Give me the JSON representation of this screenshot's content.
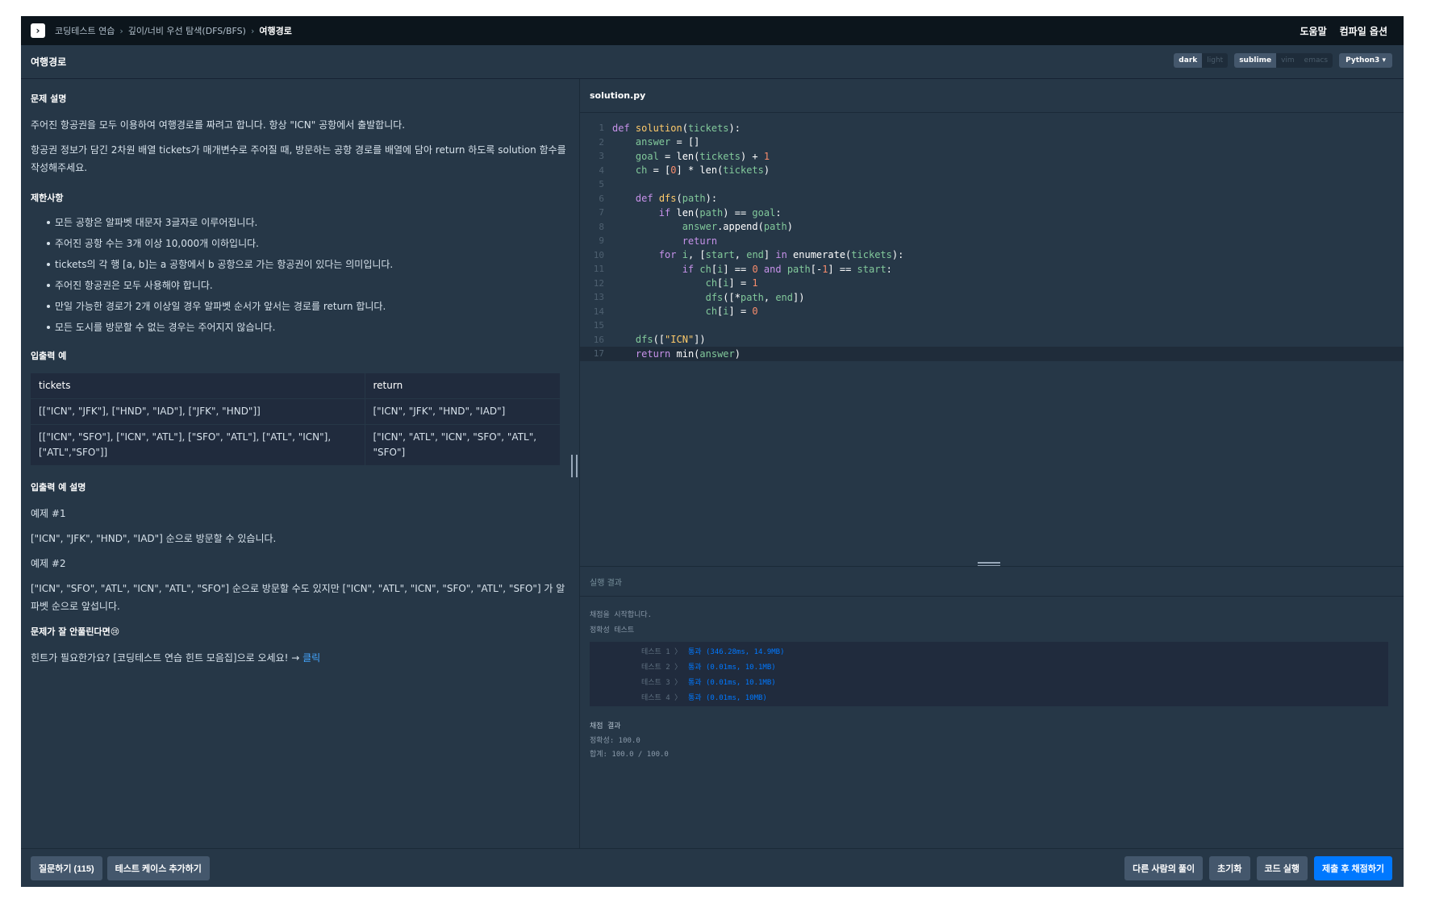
{
  "nav": {
    "crumbs": [
      "코딩테스트 연습",
      "깊이/너비 우선 탐색(DFS/BFS)",
      "여행경로"
    ],
    "help": "도움말",
    "compile_options": "컴파일 옵션"
  },
  "header": {
    "title": "여행경로",
    "theme_dark": "dark",
    "theme_light": "light",
    "keymap_sublime": "sublime",
    "keymap_vim": "vim",
    "keymap_emacs": "emacs",
    "language": "Python3"
  },
  "problem": {
    "desc_heading": "문제 설명",
    "desc_p1": "주어진 항공권을 모두 이용하여 여행경로를 짜려고 합니다. 항상 \"ICN\" 공항에서 출발합니다.",
    "desc_p2": "항공권 정보가 담긴 2차원 배열 tickets가 매개변수로 주어질 때, 방문하는 공항 경로를 배열에 담아 return 하도록 solution 함수를 작성해주세요.",
    "limits_heading": "제한사항",
    "limits": [
      "모든 공항은 알파벳 대문자 3글자로 이루어집니다.",
      "주어진 공항 수는 3개 이상 10,000개 이하입니다.",
      "tickets의 각 행 [a, b]는 a 공항에서 b 공항으로 가는 항공권이 있다는 의미입니다.",
      "주어진 항공권은 모두 사용해야 합니다.",
      "만일 가능한 경로가 2개 이상일 경우 알파벳 순서가 앞서는 경로를 return 합니다.",
      "모든 도시를 방문할 수 없는 경우는 주어지지 않습니다."
    ],
    "io_heading": "입출력 예",
    "io_columns": [
      "tickets",
      "return"
    ],
    "io_rows": [
      [
        "[[\"ICN\", \"JFK\"], [\"HND\", \"IAD\"], [\"JFK\", \"HND\"]]",
        "[\"ICN\", \"JFK\", \"HND\", \"IAD\"]"
      ],
      [
        "[[\"ICN\", \"SFO\"], [\"ICN\", \"ATL\"], [\"SFO\", \"ATL\"], [\"ATL\", \"ICN\"], [\"ATL\",\"SFO\"]]",
        "[\"ICN\", \"ATL\", \"ICN\", \"SFO\", \"ATL\", \"SFO\"]"
      ]
    ],
    "io_desc_heading": "입출력 예 설명",
    "ex1_label": "예제 #1",
    "ex1_text": "[\"ICN\", \"JFK\", \"HND\", \"IAD\"] 순으로 방문할 수 있습니다.",
    "ex2_label": "예제 #2",
    "ex2_text": "[\"ICN\", \"SFO\", \"ATL\", \"ICN\", \"ATL\", \"SFO\"] 순으로 방문할 수도 있지만 [\"ICN\", \"ATL\", \"ICN\", \"SFO\", \"ATL\", \"SFO\"] 가 알파벳 순으로 앞섭니다.",
    "hint_heading": "문제가 잘 안풀린다면😢",
    "hint_text": "힌트가 필요한가요? [코딩테스트 연습 힌트 모음집]으로 오세요! → ",
    "hint_link": "클릭"
  },
  "editor": {
    "filename": "solution.py",
    "lines": [
      "def solution(tickets):",
      "    answer = []",
      "    goal = len(tickets) + 1",
      "    ch = [0] * len(tickets)",
      "",
      "    def dfs(path):",
      "        if len(path) == goal:",
      "            answer.append(path)",
      "            return",
      "        for i, [start, end] in enumerate(tickets):",
      "            if ch[i] == 0 and path[-1] == start:",
      "                ch[i] = 1",
      "                dfs([*path, end])",
      "                ch[i] = 0",
      "",
      "    dfs([\"ICN\"])",
      "    return min(answer)"
    ]
  },
  "result": {
    "heading": "실행 결과",
    "start_msg": "채점을 시작합니다.",
    "section_label": "정확성  테스트",
    "tests": [
      {
        "label": "테스트 1 〉",
        "result": "통과 (346.28ms, 14.9MB)"
      },
      {
        "label": "테스트 2 〉",
        "result": "통과 (0.01ms, 10.1MB)"
      },
      {
        "label": "테스트 3 〉",
        "result": "통과 (0.01ms, 10.1MB)"
      },
      {
        "label": "테스트 4 〉",
        "result": "통과 (0.01ms, 10MB)"
      }
    ],
    "summary_title": "채점 결과",
    "accuracy": "정확성: 100.0",
    "total": "합계: 100.0 / 100.0"
  },
  "footer": {
    "ask": "질문하기 (115)",
    "add_testcase": "테스트 케이스 추가하기",
    "others_solution": "다른 사람의 풀이",
    "reset": "초기화",
    "run": "코드 실행",
    "submit": "제출 후 채점하기"
  },
  "colors": {
    "background": "#263747",
    "topbar": "#0c151c",
    "accent": "#0078ff"
  }
}
